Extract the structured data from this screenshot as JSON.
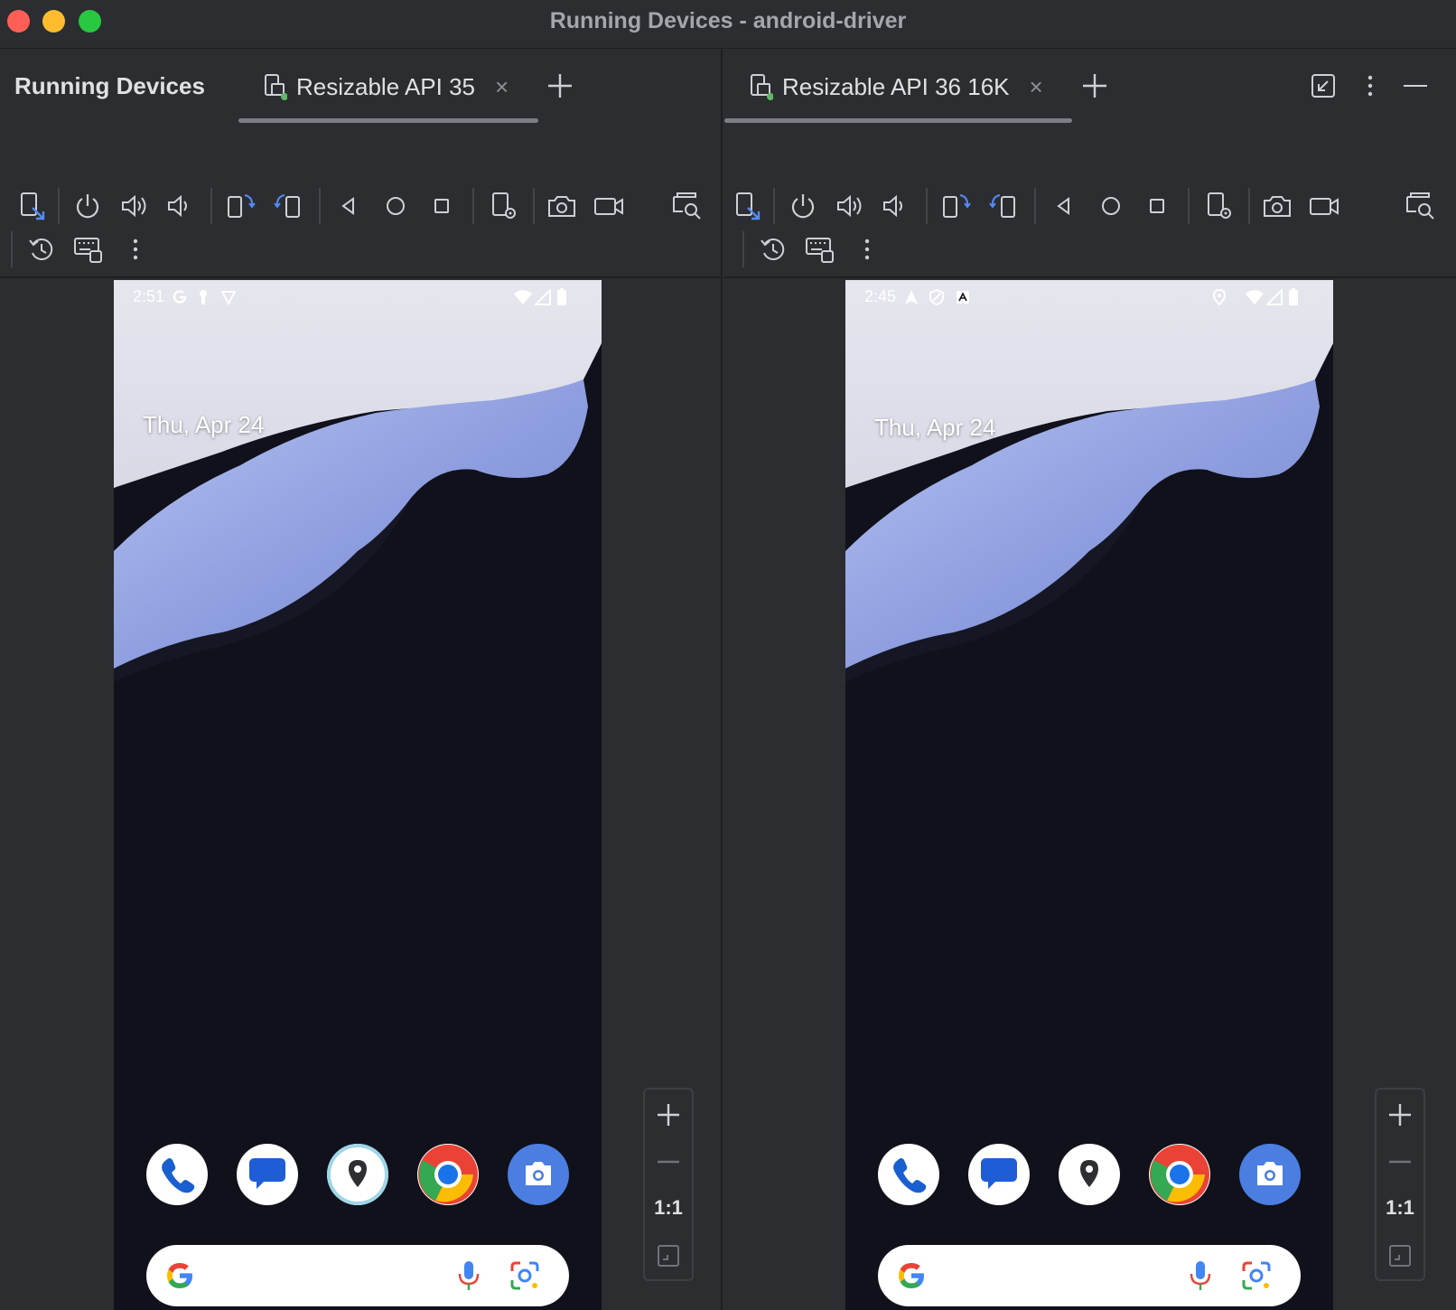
{
  "window": {
    "title": "Running Devices - android-driver"
  },
  "tool_window": {
    "title": "Running Devices"
  },
  "panes": [
    {
      "tab_label": "Resizable API 35",
      "status_time": "2:51",
      "date": "Thu, Apr 24",
      "zoom_label": "1:1"
    },
    {
      "tab_label": "Resizable API 36 16K",
      "status_time": "2:45",
      "date": "Thu, Apr 24",
      "zoom_label": "1:1"
    }
  ],
  "toolbar_icons": [
    "mirror-device-icon",
    "power-icon",
    "volume-up-icon",
    "volume-down-icon",
    "rotate-left-icon",
    "rotate-right-icon",
    "back-icon",
    "home-icon",
    "overview-icon",
    "device-settings-icon",
    "screenshot-icon",
    "screen-record-icon",
    "inspect-icon",
    "reset-icon",
    "keyboard-icon",
    "more-icon"
  ],
  "dock_apps": [
    "phone-icon",
    "messages-icon",
    "maps-icon",
    "chrome-icon",
    "camera-icon"
  ],
  "colors": {
    "ide_background": "#2b2d30",
    "accent_blue": "#548af7",
    "device_dark": "#10111b",
    "wallpaper_blue": "#8f9fe0"
  }
}
